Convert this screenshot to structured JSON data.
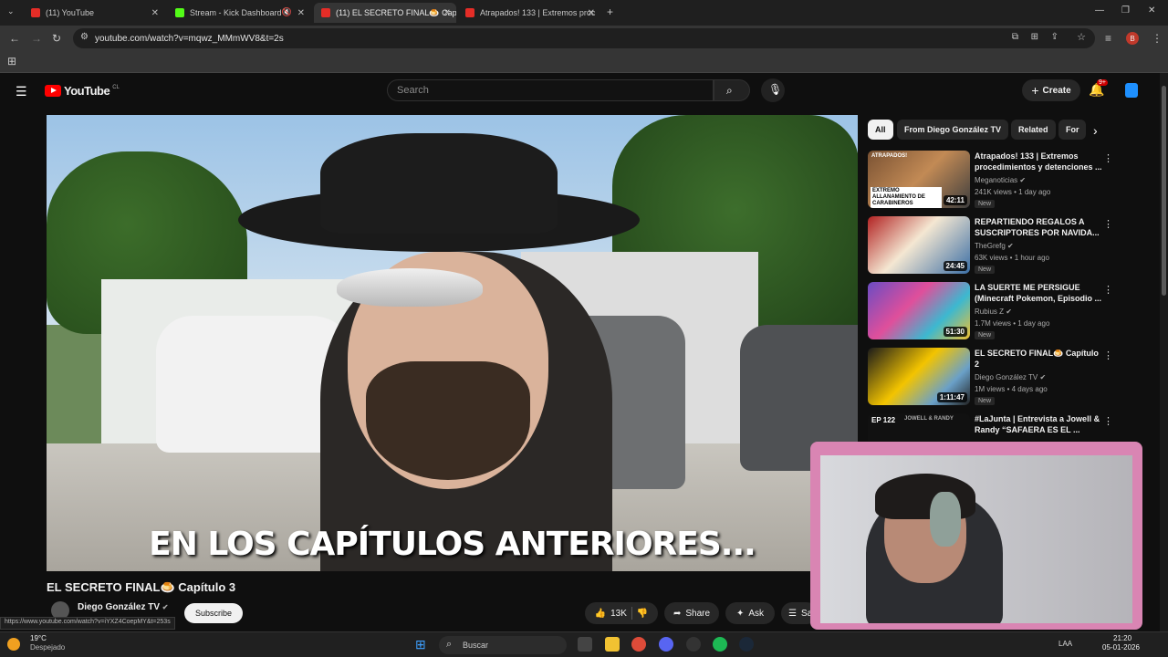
{
  "browser": {
    "tabs": [
      {
        "label": "(11) YouTube",
        "color": "#e52d27"
      },
      {
        "label": "Stream - Kick Dashboard",
        "color": "#53fc18"
      },
      {
        "label": "(11) EL SECRETO FINAL🍮 Capí",
        "color": "#e52d27"
      },
      {
        "label": "Atrapados! 133 | Extremos proc",
        "color": "#e52d27"
      }
    ],
    "url": "youtube.com/watch?v=mqwz_MMmWV8&t=2s",
    "profile_initial": "B"
  },
  "youtube": {
    "logo": "YouTube",
    "country": "CL",
    "search_placeholder": "Search",
    "create_label": "Create",
    "notif_count": "9+",
    "chips": [
      "All",
      "From Diego González TV",
      "Related",
      "For"
    ],
    "video": {
      "subtitle": "EN LOS CAPÍTULOS ANTERIORES...",
      "title": "EL SECRETO FINAL🍮 Capítulo 3",
      "channel": "Diego González TV",
      "subscribe": "Subscribe",
      "likes": "13K",
      "share": "Share",
      "ask": "Ask",
      "save": "Sa"
    },
    "recommendations": [
      {
        "title": "Atrapados! 133 | Extremos procedimientos y detenciones ...",
        "channel": "Meganoticias",
        "meta": "241K views • 1 day ago",
        "badge": "New",
        "duration": "42:11",
        "thumb_label": "EXTREMO ALLANAMIENTO DE CARABINEROS",
        "thumb_top": "ATRAPADOS!"
      },
      {
        "title": "REPARTIENDO REGALOS A SUSCRIPTORES POR NAVIDA...",
        "channel": "TheGrefg",
        "meta": "63K views • 1 hour ago",
        "badge": "New",
        "duration": "24:45",
        "thumb_label": "",
        "thumb_top": ""
      },
      {
        "title": "LA SUERTE ME PERSIGUE (Minecraft Pokemon, Episodio ...",
        "channel": "Rubius Z",
        "meta": "1.7M views • 1 day ago",
        "badge": "New",
        "duration": "51:30",
        "thumb_label": "",
        "thumb_top": ""
      },
      {
        "title": "EL SECRETO FINAL🍮 Capítulo 2",
        "channel": "Diego González TV",
        "meta": "1M views • 4 days ago",
        "badge": "New",
        "duration": "1:11:47",
        "thumb_label": "",
        "thumb_top": ""
      },
      {
        "title": "#LaJunta | Entrevista a Jowell & Randy “SAFAERA ES EL ...",
        "channel": "",
        "meta": "",
        "badge": "",
        "duration": "",
        "thumb_label": "EP 122",
        "thumb_top": "JOWELL & RANDY"
      }
    ]
  },
  "statusbar_url": "https://www.youtube.com/watch?v=iYXZ4CoepMY&t=253s",
  "taskbar": {
    "weather_temp": "19°C",
    "weather_desc": "Despejado",
    "search_label": "Buscar",
    "lang": "LAA",
    "time": "21:20",
    "date": "05-01-2026"
  }
}
